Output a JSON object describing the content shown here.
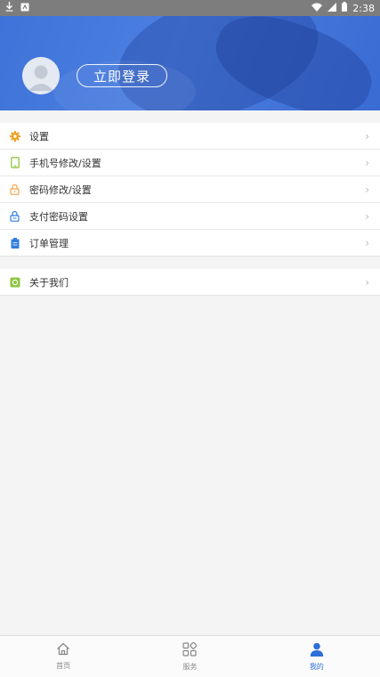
{
  "status_bar": {
    "time": "2:38"
  },
  "profile": {
    "login_label": "立即登录"
  },
  "menu_group_1": [
    {
      "label": "设置",
      "icon": "gear-icon",
      "color": "#f0a020"
    },
    {
      "label": "手机号修改/设置",
      "icon": "phone-icon",
      "color": "#8cc63f"
    },
    {
      "label": "密码修改/设置",
      "icon": "lock-icon",
      "color": "#f3a44b"
    },
    {
      "label": "支付密码设置",
      "icon": "pay-lock-icon",
      "color": "#2f7de1"
    },
    {
      "label": "订单管理",
      "icon": "clipboard-icon",
      "color": "#2f7de1"
    }
  ],
  "menu_group_2": [
    {
      "label": "关于我们",
      "icon": "info-icon",
      "color": "#8cc63f"
    }
  ],
  "tabs": [
    {
      "label": "首页",
      "icon": "home-icon",
      "active": false
    },
    {
      "label": "服务",
      "icon": "grid-icon",
      "active": false
    },
    {
      "label": "我的",
      "icon": "user-icon",
      "active": true
    }
  ],
  "colors": {
    "accent": "#2f6fd8",
    "header": "#4a7de0"
  }
}
